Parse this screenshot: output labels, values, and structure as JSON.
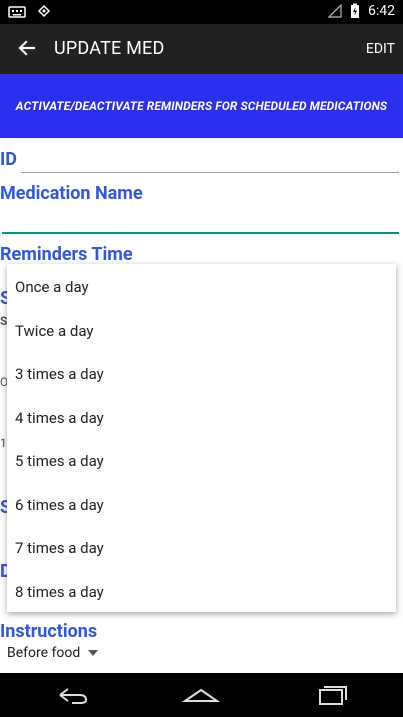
{
  "statusbar": {
    "time": "6:42"
  },
  "appbar": {
    "title": "UPDATE MED",
    "edit_label": "EDIT"
  },
  "banner": {
    "text": "ACTIVATE/DEACTIVATE REMINDERS FOR SCHEDULED MEDICATIONS"
  },
  "form": {
    "id_label": "ID",
    "medication_name_label": "Medication Name",
    "reminders_time_label": "Reminders Time",
    "instructions_label": "Instructions",
    "instructions_value": "Before food"
  },
  "dropdown": {
    "options": [
      "Once a day",
      "Twice a day",
      "3 times a day",
      "4 times a day",
      "5 times a day",
      "6 times a day",
      "7 times a day",
      "8 times a day"
    ]
  },
  "partial": {
    "s1": "S",
    "s2": "S",
    "o": "O",
    "one": "1",
    "s3": "S",
    "d": "D"
  },
  "icons": {
    "keyboard": "keyboard-icon",
    "android": "android-icon",
    "signal": "signal-icon",
    "battery": "battery-charging-icon",
    "back": "arrow-back-icon",
    "nav_back": "nav-back-icon",
    "nav_home": "nav-home-icon",
    "nav_recents": "nav-recents-icon"
  },
  "colors": {
    "accent": "#2f57e6",
    "banner": "#2b2ff0",
    "appbar": "#212121",
    "teal": "#118e7b"
  }
}
